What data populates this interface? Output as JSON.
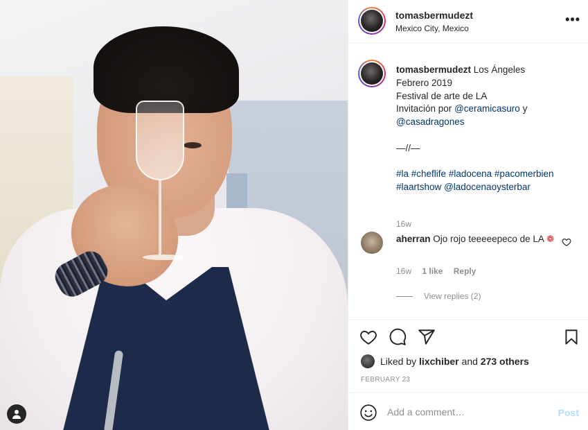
{
  "post": {
    "username": "tomasbermudezt",
    "location": "Mexico City, Mexico",
    "more_label": "•••"
  },
  "caption": {
    "username": "tomasbermudezt",
    "line1": "Los Ángeles",
    "line2": "Febrero 2019",
    "line3": "Festival de arte de LA",
    "line4_prefix": "Invitación por",
    "mention1": "@ceramicasuro",
    "line4_conj": "y",
    "mention2": "@casadragones",
    "separator": "—//—",
    "hashtags": [
      "#la",
      "#cheflife",
      "#ladocena",
      "#pacomerbien",
      "#laartshow"
    ],
    "mention3": "@ladocenaoysterbar",
    "time": "16w"
  },
  "reply": {
    "username": "aherran",
    "text": "Ojo rojo teeeeepeco de LA",
    "emoji": "❁",
    "time": "16w",
    "likes": "1 like",
    "reply_label": "Reply",
    "view_replies": "View replies (2)"
  },
  "actions": {
    "liked_by_prefix": "Liked by",
    "liked_by_user": "lixchiber",
    "liked_by_and": "and",
    "liked_by_others": "273 others",
    "date": "FEBRUARY 23"
  },
  "comment_box": {
    "placeholder": "Add a comment…",
    "post_label": "Post"
  },
  "colors": {
    "link": "#00376b",
    "muted": "#8e8e8e",
    "post_disabled": "#b2dffc",
    "emoji": "#c62828"
  }
}
